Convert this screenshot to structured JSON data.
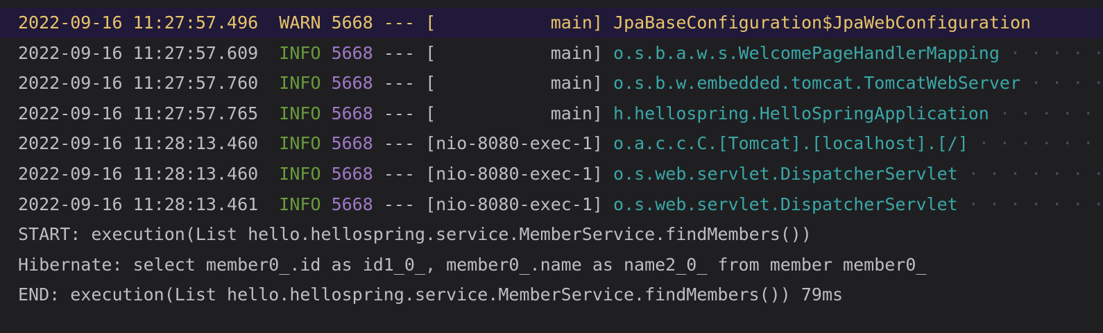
{
  "log_lines": [
    {
      "timestamp": "2022-09-16 11:27:57.496",
      "level": "WARN",
      "pid": "5668",
      "separator": "---",
      "thread": "[           main]",
      "logger": "JpaBaseConfiguration$JpaWebConfiguration",
      "highlight": true
    },
    {
      "timestamp": "2022-09-16 11:27:57.609",
      "level": "INFO",
      "pid": "5668",
      "separator": "---",
      "thread": "[           main]",
      "logger": "o.s.b.a.w.s.WelcomePageHandlerMapping"
    },
    {
      "timestamp": "2022-09-16 11:27:57.760",
      "level": "INFO",
      "pid": "5668",
      "separator": "---",
      "thread": "[           main]",
      "logger": "o.s.b.w.embedded.tomcat.TomcatWebServer"
    },
    {
      "timestamp": "2022-09-16 11:27:57.765",
      "level": "INFO",
      "pid": "5668",
      "separator": "---",
      "thread": "[           main]",
      "logger": "h.hellospring.HelloSpringApplication"
    },
    {
      "timestamp": "2022-09-16 11:28:13.460",
      "level": "INFO",
      "pid": "5668",
      "separator": "---",
      "thread": "[nio-8080-exec-1]",
      "logger": "o.a.c.c.C.[Tomcat].[localhost].[/]"
    },
    {
      "timestamp": "2022-09-16 11:28:13.460",
      "level": "INFO",
      "pid": "5668",
      "separator": "---",
      "thread": "[nio-8080-exec-1]",
      "logger": "o.s.web.servlet.DispatcherServlet"
    },
    {
      "timestamp": "2022-09-16 11:28:13.461",
      "level": "INFO",
      "pid": "5668",
      "separator": "---",
      "thread": "[nio-8080-exec-1]",
      "logger": "o.s.web.servlet.DispatcherServlet"
    }
  ],
  "plain_lines": [
    "START: execution(List hello.hellospring.service.MemberService.findMembers())",
    "Hibernate: select member0_.id as id1_0_, member0_.name as name2_0_ from member member0_",
    "END: execution(List hello.hellospring.service.MemberService.findMembers()) 79ms"
  ],
  "colors": {
    "background": "#1f1f21",
    "warn_row_background": "#21193a",
    "timestamp": "#bcbec4",
    "warn": "#e8c46a",
    "info": "#6a9b3b",
    "pid": "#a178c8",
    "logger": "#3aa7a8"
  }
}
